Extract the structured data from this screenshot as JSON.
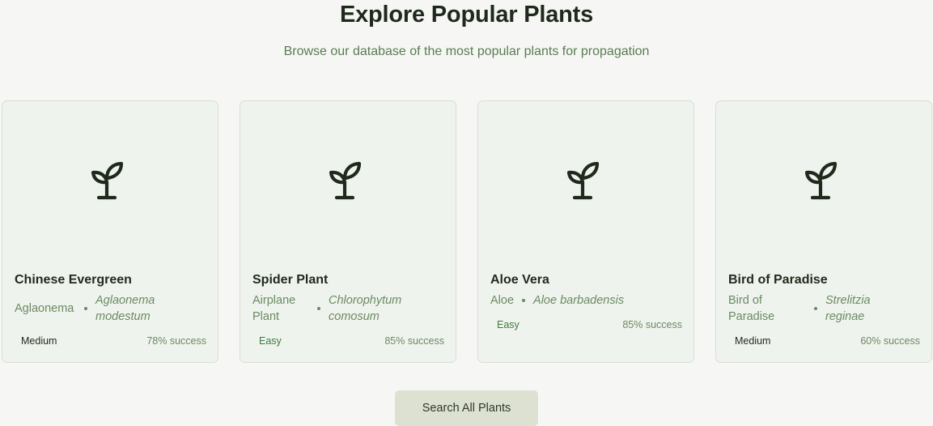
{
  "header": {
    "title": "Explore Popular Plants",
    "subtitle": "Browse our database of the most popular plants for propagation"
  },
  "cards": [
    {
      "icon": "sprout-icon",
      "name": "Chinese Evergreen",
      "common_name": "Aglaonema",
      "scientific_name": "Aglaonema modestum",
      "difficulty": "Medium",
      "success": "78% success"
    },
    {
      "icon": "sprout-icon",
      "name": "Spider Plant",
      "common_name": "Airplane Plant",
      "scientific_name": "Chlorophytum comosum",
      "difficulty": "Easy",
      "success": "85% success"
    },
    {
      "icon": "sprout-icon",
      "name": "Aloe Vera",
      "common_name": "Aloe",
      "scientific_name": "Aloe barbadensis",
      "difficulty": "Easy",
      "success": "85% success"
    },
    {
      "icon": "sprout-icon",
      "name": "Bird of Paradise",
      "common_name": "Bird of Paradise",
      "scientific_name": "Strelitzia reginae",
      "difficulty": "Medium",
      "success": "60% success"
    }
  ],
  "actions": {
    "search_all_label": "Search All Plants"
  },
  "colors": {
    "background": "#f6f7f4",
    "card_background": "#eff3ed",
    "accent_text": "#6b8a63",
    "heading_text": "#1f2a1d",
    "button_background": "#dde1d1"
  }
}
